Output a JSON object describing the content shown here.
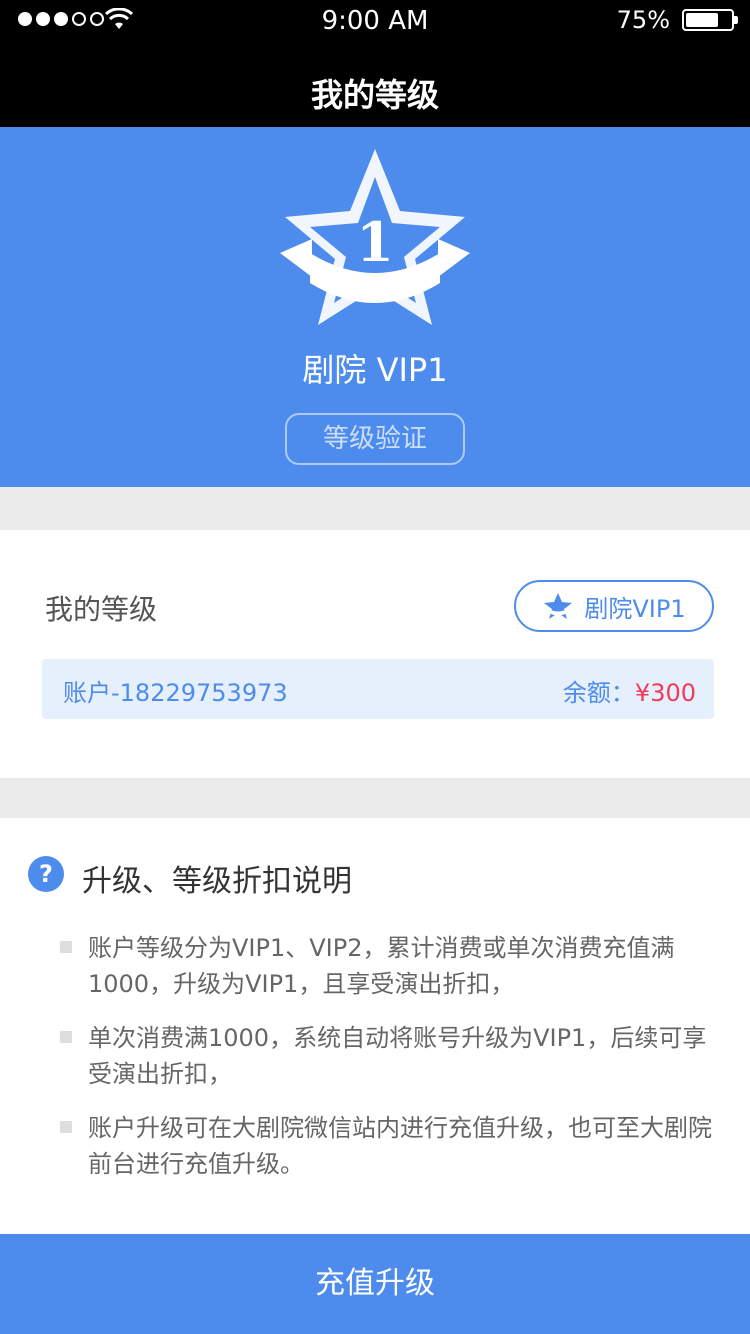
{
  "status_bar": {
    "time": "9:00 AM",
    "battery_percent": "75%",
    "battery_level": 0.75,
    "signal_bars_filled": 3,
    "signal_bars_total": 5
  },
  "header": {
    "title": "我的等级"
  },
  "hero": {
    "badge_number": "1",
    "level_name": "剧院 VIP1",
    "verify_label": "等级验证"
  },
  "level_card": {
    "label": "我的等级",
    "level_pill": "剧院VIP1",
    "account": "账户-18229753973",
    "balance_label": "余额：",
    "balance_value": "¥300"
  },
  "info": {
    "title": "升级、等级折扣说明",
    "rules": [
      "账户等级分为VIP1、VIP2，累计消费或单次消费充值满1000，升级为VIP1，且享受演出折扣，",
      "单次消费满1000，系统自动将账号升级为VIP1，后续可享受演出折扣，",
      "账户升级可在大剧院微信站内进行充值升级，也可至大剧院前台进行充值升级。"
    ]
  },
  "footer": {
    "recharge_label": "充值升级"
  },
  "colors": {
    "accent": "#4d8ced",
    "price": "#ef3a5a",
    "account_bg": "#e6effc"
  },
  "icons": {
    "signal": "signal-dots-icon",
    "wifi": "wifi-icon",
    "battery": "battery-icon",
    "badge": "star-ribbon-badge-icon",
    "pill": "star-badge-icon",
    "help": "question-circle-icon"
  }
}
